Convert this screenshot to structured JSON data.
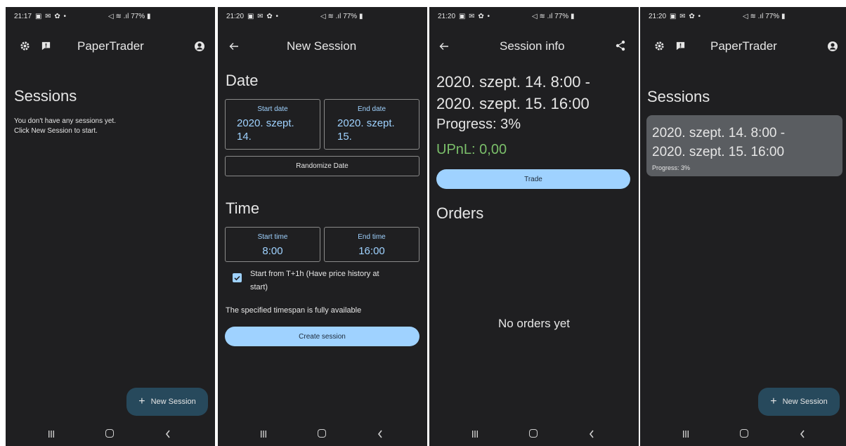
{
  "colors": {
    "background": "#1f1f21",
    "accent": "#9fd2ff",
    "fab": "#27495c",
    "profit": "#7bbf6a",
    "card": "#5a5d61"
  },
  "screens": [
    {
      "status": {
        "time": "21:17",
        "right": "77%"
      },
      "appbar": {
        "title": "PaperTrader",
        "icons": [
          "gear-icon",
          "feedback-icon",
          "account-icon"
        ]
      },
      "heading": "Sessions",
      "empty_line1": "You don't have any sessions yet.",
      "empty_line2": "Click New Session to start.",
      "fab": "New Session"
    },
    {
      "status": {
        "time": "21:20",
        "right": "77%"
      },
      "appbar": {
        "title": "New Session",
        "icons": [
          "back-arrow-icon"
        ]
      },
      "date_heading": "Date",
      "start_date_label": "Start date",
      "start_date_line1": "2020. szept.",
      "start_date_line2": "14.",
      "end_date_label": "End date",
      "end_date_line1": "2020. szept.",
      "end_date_line2": "15.",
      "randomize": "Randomize Date",
      "time_heading": "Time",
      "start_time_label": "Start time",
      "start_time": "8:00",
      "end_time_label": "End time",
      "end_time": "16:00",
      "checkbox_line1": "Start from T+1h (Have price history at",
      "checkbox_line2": "start)",
      "availability": "The specified timespan is fully available",
      "create": "Create session"
    },
    {
      "status": {
        "time": "21:20",
        "right": "77%"
      },
      "appbar": {
        "title": "Session info",
        "icons": [
          "back-arrow-icon",
          "share-icon"
        ]
      },
      "range_line1": "2020. szept. 14. 8:00 -",
      "range_line2": "2020. szept. 15. 16:00",
      "progress": "Progress: 3%",
      "upnl": "UPnL: 0,00",
      "trade": "Trade",
      "orders_heading": "Orders",
      "no_orders": "No orders yet"
    },
    {
      "status": {
        "time": "21:20",
        "right": "77%"
      },
      "appbar": {
        "title": "PaperTrader",
        "icons": [
          "gear-icon",
          "feedback-icon",
          "account-icon"
        ]
      },
      "heading": "Sessions",
      "card_line1": "2020. szept. 14. 8:00 -",
      "card_line2": "2020. szept. 15. 16:00",
      "card_progress": "Progress: 3%",
      "fab": "New Session"
    }
  ]
}
